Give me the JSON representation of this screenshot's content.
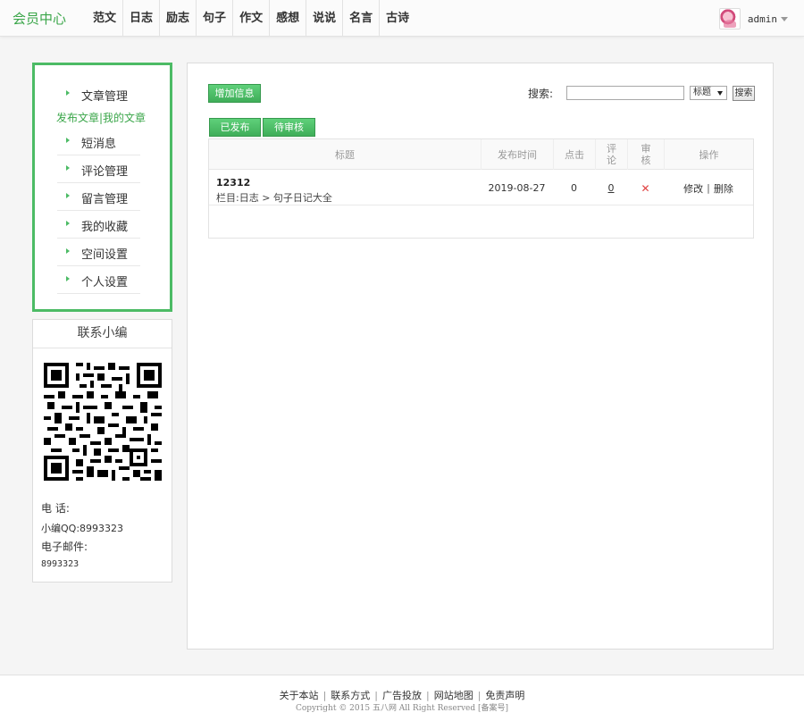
{
  "header": {
    "brand": "会员中心",
    "nav": [
      "范文",
      "日志",
      "励志",
      "句子",
      "作文",
      "感想",
      "说说",
      "名言",
      "古诗"
    ],
    "username": "admin"
  },
  "sidebar": {
    "items": [
      {
        "label": "文章管理"
      },
      {
        "label": "短消息"
      },
      {
        "label": "评论管理"
      },
      {
        "label": "留言管理"
      },
      {
        "label": "我的收藏"
      },
      {
        "label": "空间设置"
      },
      {
        "label": "个人设置"
      }
    ],
    "submenu": "发布文章|我的文章"
  },
  "contact": {
    "title": "联系小编",
    "phone_label": "电  话:",
    "qq": "小编QQ:8993323",
    "email_label": "电子邮件:",
    "email_value": "8993323"
  },
  "toolbar": {
    "add_label": "增加信息",
    "search_label": "搜索:",
    "search_value": "",
    "select_value": "标题",
    "search_button": "搜索"
  },
  "tabs": {
    "published": "已发布",
    "pending": "待审核"
  },
  "table": {
    "headers": {
      "title": "标题",
      "time": "发布时间",
      "clicks": "点击",
      "comments": "评论",
      "review": "审核",
      "action": "操作"
    },
    "rows": [
      {
        "title": "12312",
        "category": "栏目:日志 > 句子日记大全",
        "time": "2019-08-27",
        "clicks": "0",
        "comments": "0",
        "review": "✕",
        "edit": "修改",
        "delete": "删除"
      }
    ]
  },
  "footer": {
    "links": [
      "关于本站",
      "联系方式",
      "广告投放",
      "网站地图",
      "免责声明"
    ],
    "copyright": "Copyright © 2015 五八网 All Right Reserved [备案号]"
  },
  "colors": {
    "accent": "#4cbb65",
    "brand_text": "#3aa649",
    "danger": "#e04040"
  }
}
